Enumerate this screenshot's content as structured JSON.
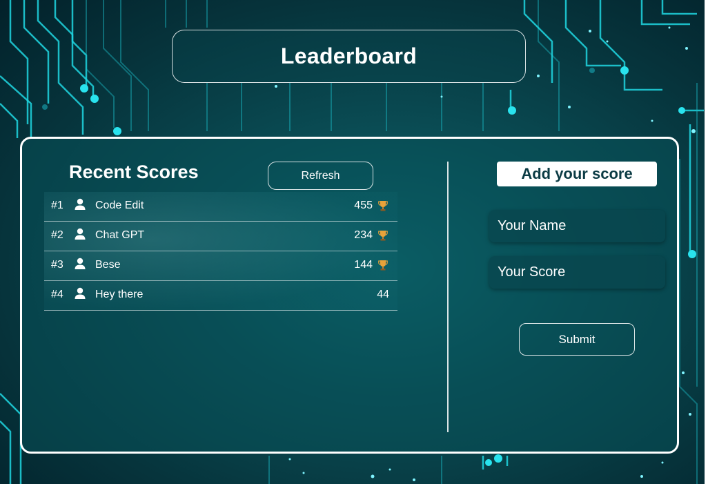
{
  "header": {
    "title": "Leaderboard"
  },
  "recent": {
    "title": "Recent Scores",
    "refresh_label": "Refresh",
    "rows": [
      {
        "rank": "#1",
        "name": "Code Edit",
        "score": "455",
        "icon": "user-icon",
        "trophy": true
      },
      {
        "rank": "#2",
        "name": "Chat GPT",
        "score": "234",
        "icon": "user-icon",
        "trophy": true
      },
      {
        "rank": "#3",
        "name": "Bese",
        "score": "144",
        "icon": "user-icon",
        "trophy": true
      },
      {
        "rank": "#4",
        "name": "Hey there",
        "score": "44",
        "icon": "user-icon",
        "trophy": false
      }
    ]
  },
  "form": {
    "title": "Add your score",
    "name_placeholder": "Your Name",
    "score_placeholder": "Your Score",
    "submit_label": "Submit"
  },
  "colors": {
    "accent": "#20d6e0",
    "panel_border": "#ffffff",
    "background": "#0a4d55",
    "trophy": "#e8a33a"
  }
}
